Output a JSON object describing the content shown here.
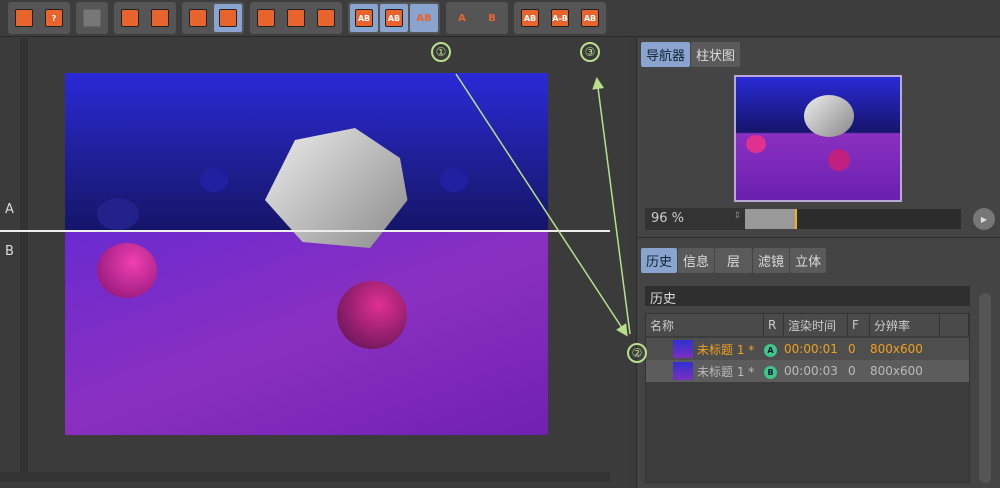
{
  "toolbar": {
    "buttons": [
      {
        "icon": "open-icon",
        "label": ""
      },
      {
        "icon": "save-icon",
        "label": "?"
      },
      {
        "icon": "grid-icon",
        "label": ""
      },
      {
        "icon": "add-to-history-icon",
        "label": ""
      },
      {
        "icon": "import-icon",
        "label": ""
      },
      {
        "icon": "delete-icon",
        "label": ""
      },
      {
        "icon": "compare-icon",
        "label": ""
      },
      {
        "icon": "view-frame-icon",
        "label": ""
      },
      {
        "icon": "view-region-icon",
        "label": ""
      },
      {
        "icon": "channels-icon",
        "label": ""
      },
      {
        "icon": "ab-split-icon",
        "label": "AB"
      },
      {
        "icon": "ab-view-icon",
        "label": "AB"
      },
      {
        "icon": "ab-large-icon",
        "label": "AB"
      },
      {
        "icon": "set-a-icon",
        "label": "A"
      },
      {
        "icon": "set-b-icon",
        "label": "B"
      },
      {
        "icon": "ab-vertical-icon",
        "label": "AB"
      },
      {
        "icon": "ab-horizontal-icon",
        "label": "A-B"
      },
      {
        "icon": "ab-swap-icon",
        "label": "AB"
      }
    ]
  },
  "viewport": {
    "label_a": "A",
    "label_b": "B"
  },
  "annotations": [
    "①",
    "②",
    "③"
  ],
  "navigator": {
    "tabs": [
      "导航器",
      "柱状图"
    ],
    "zoom": "96 %",
    "zoom_fraction": 0.24
  },
  "history": {
    "tabs": [
      "历史",
      "信息",
      "层",
      "滤镜",
      "立体"
    ],
    "title": "历史",
    "columns": [
      "名称",
      "R",
      "渲染时间",
      "F",
      "分辨率"
    ],
    "rows": [
      {
        "name": "未标题 1 *",
        "badge": "A",
        "time": "00:00:01",
        "frame": "0",
        "res": "800x600"
      },
      {
        "name": "未标题 1 *",
        "badge": "B",
        "time": "00:00:03",
        "frame": "0",
        "res": "800x600"
      }
    ]
  },
  "colors": {
    "accent": "#e8642c",
    "selected": "#8aa4d0",
    "annotation": "#b8e08a",
    "active_row": "#f0a020"
  }
}
